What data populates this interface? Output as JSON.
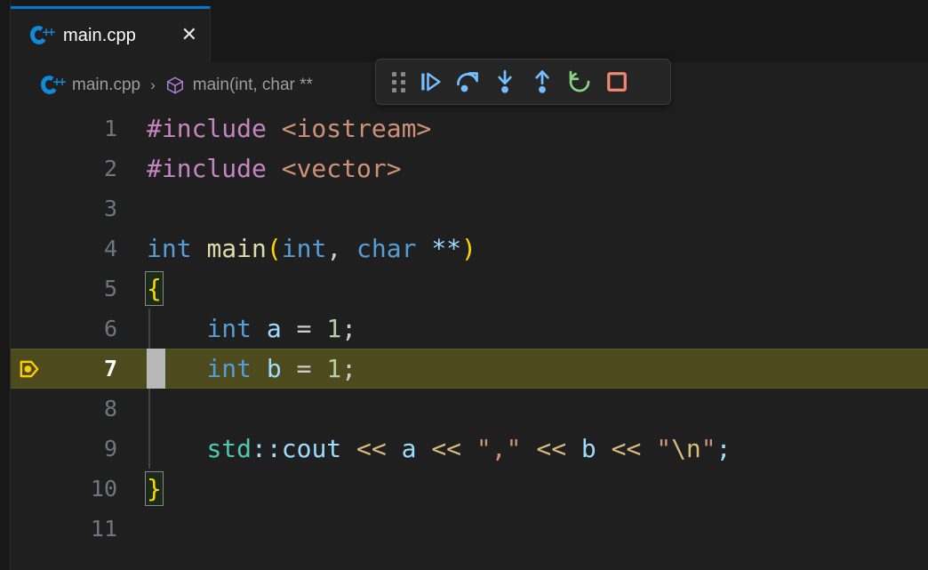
{
  "window": {
    "background": "#1f1f1f",
    "accent": "#0078d4"
  },
  "tab": {
    "icon": "cpp-file-icon",
    "label": "main.cpp",
    "close_label": "✕",
    "active": true
  },
  "breadcrumb": {
    "file_icon": "cpp-file-icon",
    "file": "main.cpp",
    "separator": "›",
    "symbol_icon": "symbol-method-icon",
    "symbol": "main(int, char **"
  },
  "debug_toolbar": {
    "drag_handle": "drag-handle-icon",
    "buttons": [
      {
        "name": "continue-button",
        "icon": "continue-icon",
        "title": "Continue",
        "color": "#75beff"
      },
      {
        "name": "step-over-button",
        "icon": "step-over-icon",
        "title": "Step Over",
        "color": "#75beff"
      },
      {
        "name": "step-into-button",
        "icon": "step-into-icon",
        "title": "Step Into",
        "color": "#75beff"
      },
      {
        "name": "step-out-button",
        "icon": "step-out-icon",
        "title": "Step Out",
        "color": "#75beff"
      },
      {
        "name": "restart-button",
        "icon": "restart-icon",
        "title": "Restart",
        "color": "#89d185"
      },
      {
        "name": "stop-button",
        "icon": "stop-icon",
        "title": "Stop",
        "color": "#f48771"
      }
    ]
  },
  "editor": {
    "language": "cpp",
    "current_execution_line": 7,
    "execution_marker": "debug-stackframe-icon",
    "current_line_highlight": "#4d4a1d",
    "lines": [
      {
        "num": "1",
        "tokens": [
          {
            "t": "#include ",
            "c": "tk-pre"
          },
          {
            "t": "<iostream>",
            "c": "tk-header"
          }
        ]
      },
      {
        "num": "2",
        "tokens": [
          {
            "t": "#include ",
            "c": "tk-pre"
          },
          {
            "t": "<vector>",
            "c": "tk-header"
          }
        ]
      },
      {
        "num": "3",
        "tokens": []
      },
      {
        "num": "4",
        "tokens": [
          {
            "t": "int ",
            "c": "tk-key"
          },
          {
            "t": "main",
            "c": "tk-func"
          },
          {
            "t": "(",
            "c": "tk-paren"
          },
          {
            "t": "int",
            "c": "tk-key"
          },
          {
            "t": ", ",
            "c": "tk-punc"
          },
          {
            "t": "char ",
            "c": "tk-key"
          },
          {
            "t": "**",
            "c": "tk-var"
          },
          {
            "t": ")",
            "c": "tk-paren"
          }
        ]
      },
      {
        "num": "5",
        "tokens": [
          {
            "t": "{",
            "c": "tk-brace",
            "match": true
          }
        ]
      },
      {
        "num": "6",
        "tokens": [
          {
            "t": "    ",
            "c": "tk-punc"
          },
          {
            "t": "int ",
            "c": "tk-key"
          },
          {
            "t": "a",
            "c": "tk-var"
          },
          {
            "t": " = ",
            "c": "tk-punc"
          },
          {
            "t": "1",
            "c": "tk-num"
          },
          {
            "t": ";",
            "c": "tk-punc"
          }
        ]
      },
      {
        "num": "7",
        "tokens": [
          {
            "t": "    ",
            "c": "tk-punc"
          },
          {
            "t": "int ",
            "c": "tk-key"
          },
          {
            "t": "b",
            "c": "tk-var"
          },
          {
            "t": " = ",
            "c": "tk-punc"
          },
          {
            "t": "1",
            "c": "tk-num"
          },
          {
            "t": ";",
            "c": "tk-punc"
          }
        ]
      },
      {
        "num": "8",
        "tokens": []
      },
      {
        "num": "9",
        "tokens": [
          {
            "t": "    ",
            "c": "tk-punc"
          },
          {
            "t": "std",
            "c": "tk-ns"
          },
          {
            "t": "::",
            "c": "tk-var"
          },
          {
            "t": "cout",
            "c": "tk-var"
          },
          {
            "t": " ",
            "c": "tk-punc"
          },
          {
            "t": "<<",
            "c": "tk-op"
          },
          {
            "t": " ",
            "c": "tk-punc"
          },
          {
            "t": "a",
            "c": "tk-var"
          },
          {
            "t": " ",
            "c": "tk-punc"
          },
          {
            "t": "<<",
            "c": "tk-op"
          },
          {
            "t": " ",
            "c": "tk-punc"
          },
          {
            "t": "\",\"",
            "c": "tk-str"
          },
          {
            "t": " ",
            "c": "tk-punc"
          },
          {
            "t": "<<",
            "c": "tk-op"
          },
          {
            "t": " ",
            "c": "tk-punc"
          },
          {
            "t": "b",
            "c": "tk-var"
          },
          {
            "t": " ",
            "c": "tk-punc"
          },
          {
            "t": "<<",
            "c": "tk-op"
          },
          {
            "t": " ",
            "c": "tk-punc"
          },
          {
            "t": "\"",
            "c": "tk-str"
          },
          {
            "t": "\\n",
            "c": "tk-esc"
          },
          {
            "t": "\"",
            "c": "tk-str"
          },
          {
            "t": ";",
            "c": "tk-var"
          }
        ]
      },
      {
        "num": "10",
        "tokens": [
          {
            "t": "}",
            "c": "tk-brace",
            "match": true
          }
        ]
      },
      {
        "num": "11",
        "tokens": []
      }
    ]
  }
}
